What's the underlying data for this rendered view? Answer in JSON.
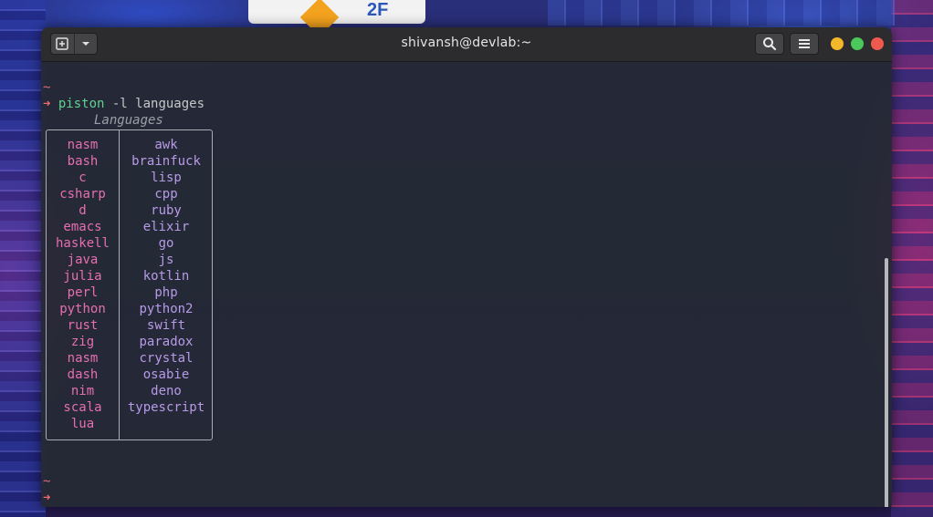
{
  "window": {
    "title": "shivansh@devlab:~",
    "controls": {
      "minimize_color": "#f3b72c",
      "maximize_color": "#4ac85a",
      "close_color": "#ee5a4d"
    }
  },
  "wallpaper": {
    "sign_text": "2F"
  },
  "terminal": {
    "prompt_tilde": "~",
    "prompt_arrow": "➜",
    "command": "piston",
    "command_args": " -l languages",
    "table_title": "Languages",
    "languages_left": [
      "nasm",
      "bash",
      "c",
      "csharp",
      "d",
      "emacs",
      "haskell",
      "java",
      "julia",
      "perl",
      "python",
      "rust",
      "zig",
      "nasm",
      "dash",
      "nim",
      "scala",
      "lua"
    ],
    "languages_right": [
      "awk",
      "brainfuck",
      "lisp",
      "cpp",
      "ruby",
      "elixir",
      "go",
      "js",
      "kotlin",
      "php",
      "python2",
      "swift",
      "paradox",
      "crystal",
      "osabie",
      "deno",
      "typescript"
    ],
    "final_tilde": "~",
    "final_arrow": "➜"
  },
  "colors": {
    "left_column": "#e66fb0",
    "right_column": "#b79ae8",
    "command": "#5fd38d",
    "prompt": "#ee6a6e"
  },
  "icons": [
    "new-tab-icon",
    "chevron-down-icon",
    "search-icon",
    "hamburger-menu-icon"
  ]
}
